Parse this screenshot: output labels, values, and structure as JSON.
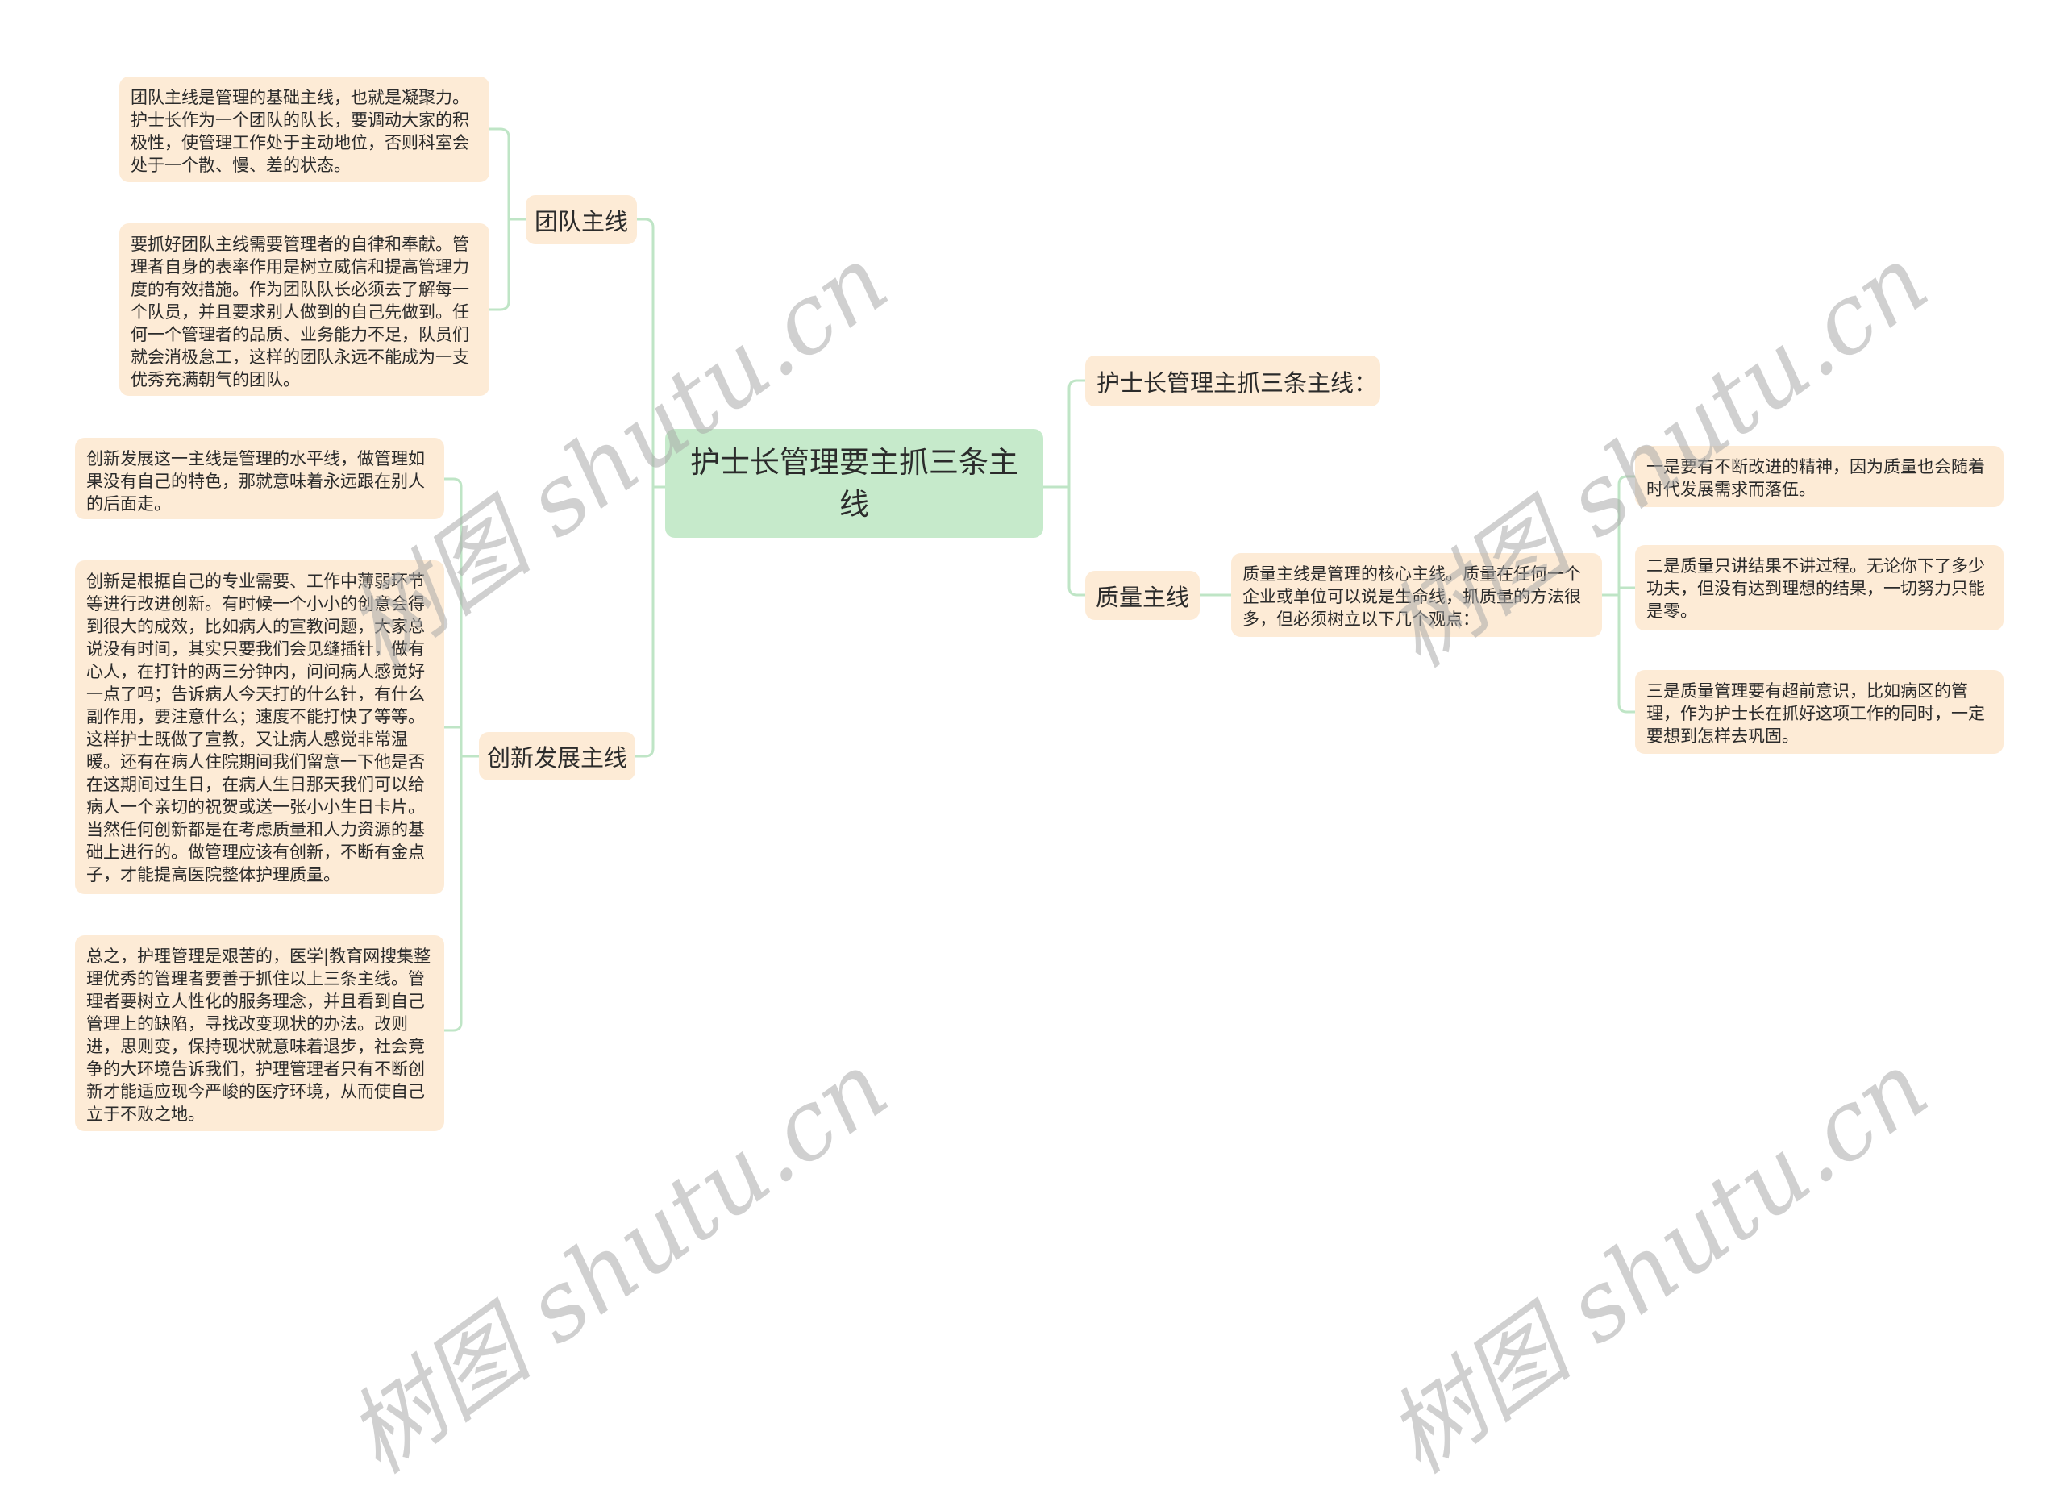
{
  "root": {
    "title": "护士长管理要主抓三条主线"
  },
  "branches": {
    "team": {
      "label": "团队主线",
      "details": [
        "团队主线是管理的基础主线，也就是凝聚力。护士长作为一个团队的队长，要调动大家的积极性，使管理工作处于主动地位，否则科室会处于一个散、慢、差的状态。",
        "要抓好团队主线需要管理者的自律和奉献。管理者自身的表率作用是树立威信和提高管理力度的有效措施。作为团队队长必须去了解每一个队员，并且要求别人做到的自己先做到。任何一个管理者的品质、业务能力不足，队员们就会消极怠工，这样的团队永远不能成为一支优秀充满朝气的团队。"
      ]
    },
    "innovation": {
      "label": "创新发展主线",
      "details": [
        "创新发展这一主线是管理的水平线，做管理如果没有自己的特色，那就意味着永远跟在别人的后面走。",
        "创新是根据自己的专业需要、工作中薄弱环节等进行改进创新。有时候一个小小的创意会得到很大的成效，比如病人的宣教问题，大家总说没有时间，其实只要我们会见缝插针，做有心人，在打针的两三分钟内，问问病人感觉好一点了吗；告诉病人今天打的什么针，有什么副作用，要注意什么；速度不能打快了等等。这样护士既做了宣教，又让病人感觉非常温暖。还有在病人住院期间我们留意一下他是否在这期间过生日，在病人生日那天我们可以给病人一个亲切的祝贺或送一张小小生日卡片。当然任何创新都是在考虑质量和人力资源的基础上进行的。做管理应该有创新，不断有金点子，才能提高医院整体护理质量。",
        "总之，护理管理是艰苦的，医学|教育网搜集整理优秀的管理者要善于抓住以上三条主线。管理者要树立人性化的服务理念，并且看到自己管理上的缺陷，寻找改变现状的办法。改则进，思则变，保持现状就意味着退步，社会竞争的大环境告诉我们，护理管理者只有不断创新才能适应现今严峻的医疗环境，从而使自己立于不败之地。"
      ]
    },
    "summary": {
      "label": "护士长管理主抓三条主线："
    },
    "quality": {
      "label": "质量主线",
      "description": "质量主线是管理的核心主线。质量在任何一个企业或单位可以说是生命线，抓质量的方法很多，但必须树立以下几个观点：",
      "points": [
        "一是要有不断改进的精神，因为质量也会随着时代发展需求而落伍。",
        "二是质量只讲结果不讲过程。无论你下了多少功夫，但没有达到理想的结果，一切努力只能是零。",
        "三是质量管理要有超前意识，比如病区的管理，作为护士长在抓好这项工作的同时，一定要想到怎样去巩固。"
      ]
    }
  },
  "watermark": {
    "text": "树图 shutu.cn"
  },
  "colors": {
    "node_fill": "#fdebd6",
    "root_fill": "#c6eacb",
    "connector": "#bfe5c6"
  }
}
